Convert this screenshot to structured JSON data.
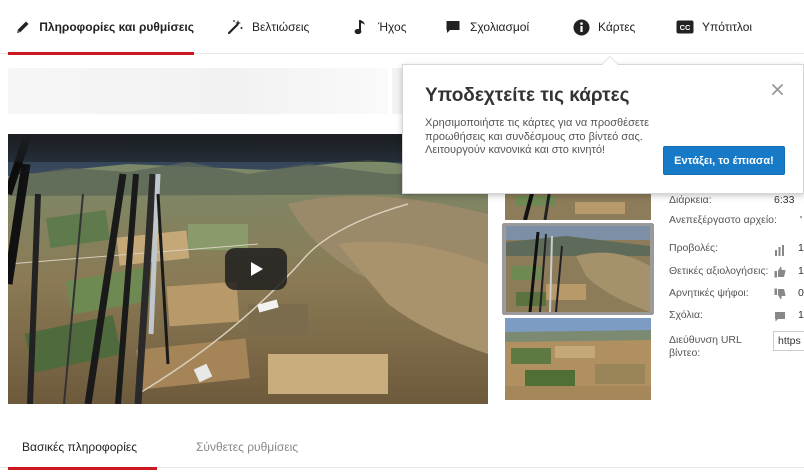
{
  "tabs": {
    "info": "Πληροφορίες και ρυθμίσεις",
    "enhancements": "Βελτιώσεις",
    "audio": "Ήχος",
    "annotations": "Σχολιασμοί",
    "cards": "Κάρτες",
    "subtitles": "Υπότιτλοι",
    "active": "info"
  },
  "icons": {
    "info": "pencil-icon",
    "enhancements": "magic-wand-icon",
    "audio": "music-note-icon",
    "annotations": "speech-bubble-icon",
    "cards": "info-circle-icon",
    "subtitles": "cc-icon"
  },
  "popup": {
    "title": "Υποδεχτείτε τις κάρτες",
    "body": "Χρησιμοποιήστε τις κάρτες για να προσθέσετε προωθήσεις και συνδέσμους στο βίντεό σας. Λειτουργούν κανονικά και στο κινητό!",
    "button": "Εντάξει, το έπιασα!",
    "close_icon": "close-icon"
  },
  "meta": {
    "duration_label": "Διάρκεια:",
    "duration_value": "6:33",
    "raw_file_label": "Ανεπεξέργαστο αρχείο:",
    "raw_file_value": "'",
    "views_label": "Προβολές:",
    "views_value": "1",
    "likes_label": "Θετικές αξιολογήσεις:",
    "likes_value": "1",
    "dislikes_label": "Αρνητικές ψήφοι:",
    "dislikes_value": "0",
    "comments_label": "Σχόλια:",
    "comments_value": "1",
    "url_label": "Διεύθυνση URL βίντεο:",
    "url_value": "https"
  },
  "subtabs": {
    "basic": "Βασικές πληροφορίες",
    "advanced": "Σύνθετες ρυθμίσεις",
    "active": "basic"
  },
  "colors": {
    "accent_red": "#cc181e",
    "button_blue": "#167ac6"
  }
}
